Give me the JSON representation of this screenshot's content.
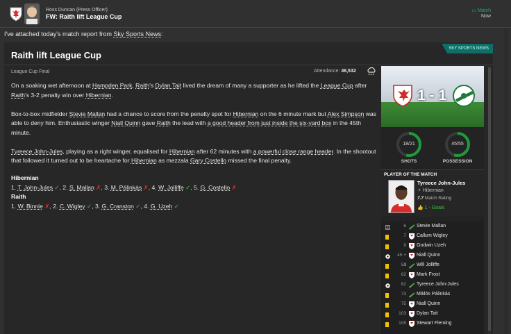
{
  "header": {
    "sender": "Ross Duncan (Press Officer)",
    "subject": "FW: Raith lift League Cup",
    "match_tag": "Match",
    "time": "Now"
  },
  "intro": {
    "text": "I've attached today's match report from ",
    "link": "Sky Sports News",
    "end": ":"
  },
  "article": {
    "title": "Raith lift League Cup",
    "source_badge": "SKY SPORTS NEWS",
    "competition": "League Cup Final",
    "attendance_label": "Attendance:",
    "attendance_value": "46,532",
    "p1": {
      "a": "On a soaking wet afternoon at ",
      "b": "Hampden Park",
      "c": ", ",
      "d": "Raith",
      "e": "'s ",
      "f": "Dylan Tait",
      "g": " lived the dream of many a supporter as he lifted the ",
      "h": "League Cup",
      "i": " after ",
      "j": "Raith",
      "k": "'s 3-2 penalty win over ",
      "l": "Hibernian",
      "m": "."
    },
    "p2": {
      "a": "Box-to-box midfielder ",
      "b": "Stevie Mallan",
      "c": " had a chance to score from the penalty spot for ",
      "d": "Hibernian",
      "e": " on the 6 minute mark but ",
      "f": "Alex Simpson",
      "g": " was able to deny him. Enthusiastic winger ",
      "h": "Niall Quinn",
      "i": " gave ",
      "j": "Raith",
      "k": " the lead with ",
      "l": "a good header from just inside the six-yard box",
      "m": " in the 45th minute."
    },
    "p3": {
      "a": "Tyreece John-Jules",
      "b": ", playing as a right winger, equalised for ",
      "c": "Hibernian",
      "d": " after 62 minutes with ",
      "e": "a powerful close range header",
      "f": ". In the shootout that followed it turned out to be heartache for ",
      "g": "Hibernian",
      "h": " as mezzala ",
      "i": "Gary Costello",
      "j": " missed the final penalty."
    }
  },
  "shootout": {
    "team1": "Hibernian",
    "team1_kicks": [
      {
        "n": "1.",
        "name": "T. John-Jules",
        "r": "✓"
      },
      {
        "n": "2.",
        "name": "S. Mallan",
        "r": "✗"
      },
      {
        "n": "3.",
        "name": "M. Pálinkás",
        "r": "✗"
      },
      {
        "n": "4.",
        "name": "W. Jolliffe",
        "r": "✓"
      },
      {
        "n": "5.",
        "name": "G. Costello",
        "r": "✗"
      }
    ],
    "team2": "Raith",
    "team2_kicks": [
      {
        "n": "1.",
        "name": "W. Binnie",
        "r": "✗"
      },
      {
        "n": "2.",
        "name": "C. Wigley",
        "r": "✓"
      },
      {
        "n": "3.",
        "name": "G. Cranston",
        "r": "✓"
      },
      {
        "n": "4.",
        "name": "G. Uzeh",
        "r": "✓"
      }
    ]
  },
  "scoreboard": {
    "score": "1 - 1"
  },
  "stats": {
    "shots": {
      "label": "SHOTS",
      "text": "18/21",
      "home": 18,
      "away": 21
    },
    "possession": {
      "label": "POSSESSION",
      "text": "45/55",
      "home": 45,
      "away": 55
    }
  },
  "potm": {
    "heading": "PLAYER OF THE MATCH",
    "name": "Tyreece John-Jules",
    "club": "Hibernian",
    "rating": "7.7",
    "rating_label": "Match Rating",
    "goals": "1 - Goals"
  },
  "events": [
    {
      "type": "penalty-miss",
      "min": "6",
      "team": "hib",
      "player": "Stevie Mallan"
    },
    {
      "type": "yellow",
      "min": "7",
      "team": "raith",
      "player": "Callum Wigley"
    },
    {
      "type": "yellow",
      "min": "9",
      "team": "raith",
      "player": "Godwin Uzeh"
    },
    {
      "type": "goal",
      "min": "45 + 1",
      "team": "raith",
      "player": "Niall Quinn"
    },
    {
      "type": "yellow",
      "min": "50",
      "team": "hib",
      "player": "Will Jolliffe"
    },
    {
      "type": "yellow",
      "min": "62",
      "team": "raith",
      "player": "Mark Frost"
    },
    {
      "type": "goal",
      "min": "62",
      "team": "hib",
      "player": "Tyreece John-Jules"
    },
    {
      "type": "yellow",
      "min": "73",
      "team": "hib",
      "player": "Miklós Pálinkás"
    },
    {
      "type": "yellow",
      "min": "75",
      "team": "raith",
      "player": "Niall Quinn"
    },
    {
      "type": "yellow",
      "min": "103",
      "team": "raith",
      "player": "Dylan Tait"
    },
    {
      "type": "yellow",
      "min": "105",
      "team": "raith",
      "player": "Stewart Fleming"
    }
  ],
  "colors": {
    "raith_red": "#d32a2a",
    "hib_green": "#1f7a3a",
    "accent": "#0f6f68",
    "check": "#3fc24a",
    "cross": "#d33",
    "yellow": "#f2c200"
  }
}
